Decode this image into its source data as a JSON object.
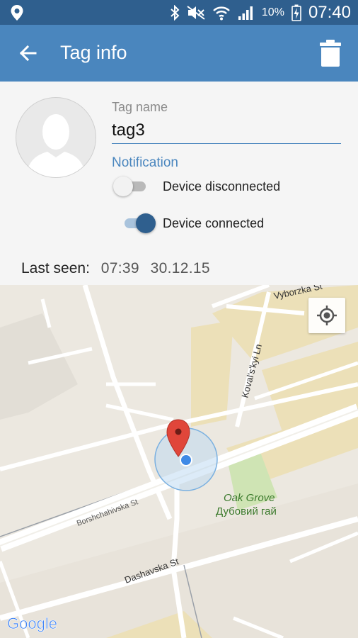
{
  "status_bar": {
    "battery_percent": "10%",
    "time": "07:40",
    "icons": [
      "location-icon",
      "bluetooth-icon",
      "mute-icon",
      "wifi-icon",
      "signal-icon",
      "battery-charging-icon"
    ]
  },
  "app_bar": {
    "title": "Tag info",
    "back_icon": "arrow-back-icon",
    "delete_icon": "trash-icon",
    "color": "#4a86be"
  },
  "form": {
    "tag_name_label": "Tag name",
    "tag_name_value": "tag3",
    "notification_label": "Notification",
    "switches": [
      {
        "label": "Device disconnected",
        "on": false
      },
      {
        "label": "Device connected",
        "on": true
      }
    ],
    "last_seen_label": "Last seen:",
    "last_seen_time": "07:39",
    "last_seen_date": "30.12.15"
  },
  "map": {
    "labels": {
      "street_1": "Vyborzka St",
      "street_2": "Koval's'kyi Ln",
      "street_3": "Borshchahivska St",
      "street_4": "Dashavska St",
      "park_en": "Oak Grove",
      "park_uk": "Дубовий гай"
    },
    "brand": "Google",
    "my_location_icon": "my-location-icon",
    "marker_color": "#e0463a",
    "location_dot_color": "#3f8ae6"
  }
}
